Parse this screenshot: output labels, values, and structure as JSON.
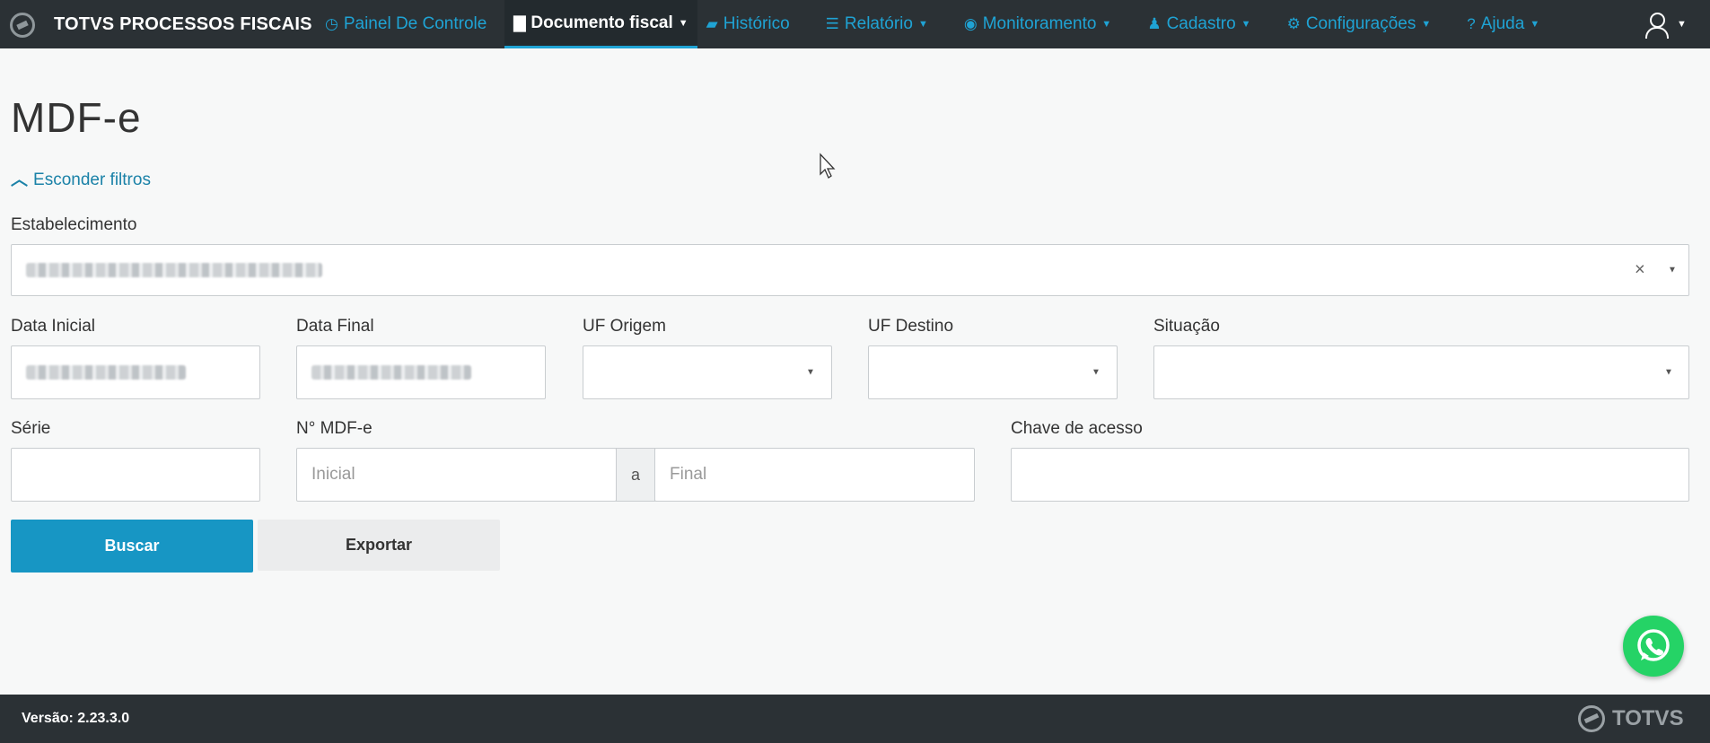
{
  "app": {
    "title": "TOTVS PROCESSOS FISCAIS"
  },
  "nav": {
    "items": [
      {
        "label": "Painel De Controle",
        "icon": "dashboard-icon",
        "has_caret": false,
        "active": false
      },
      {
        "label": "Documento fiscal",
        "icon": "document-icon",
        "has_caret": true,
        "active": true
      },
      {
        "label": "Histórico",
        "icon": "folder-open-icon",
        "has_caret": false,
        "active": false
      },
      {
        "label": "Relatório",
        "icon": "list-icon",
        "has_caret": true,
        "active": false
      },
      {
        "label": "Monitoramento",
        "icon": "eye-icon",
        "has_caret": true,
        "active": false
      },
      {
        "label": "Cadastro",
        "icon": "register-icon",
        "has_caret": true,
        "active": false
      },
      {
        "label": "Configurações",
        "icon": "gear-icon",
        "has_caret": true,
        "active": false
      },
      {
        "label": "Ajuda",
        "icon": "question-icon",
        "has_caret": true,
        "active": false
      }
    ]
  },
  "page": {
    "title": "MDF-e",
    "toggle_filters": "Esconder filtros"
  },
  "filters": {
    "estabelecimento": {
      "label": "Estabelecimento",
      "value_hidden": true
    },
    "data_inicial": {
      "label": "Data Inicial",
      "value_hidden": true
    },
    "data_final": {
      "label": "Data Final",
      "value_hidden": true
    },
    "uf_origem": {
      "label": "UF Origem",
      "value": ""
    },
    "uf_destino": {
      "label": "UF Destino",
      "value": ""
    },
    "situacao": {
      "label": "Situação",
      "value": ""
    },
    "serie": {
      "label": "Série",
      "value": ""
    },
    "numero": {
      "label": "N° MDF-e",
      "from_placeholder": "Inicial",
      "separator": "a",
      "to_placeholder": "Final"
    },
    "chave": {
      "label": "Chave de acesso",
      "value": ""
    }
  },
  "actions": {
    "search_label": "Buscar",
    "export_label": "Exportar"
  },
  "footer": {
    "version": "Versão: 2.23.3.0",
    "logo_text": "TOTVS"
  },
  "colors": {
    "navbar_bg": "#2b3135",
    "accent": "#1fa3d4",
    "primary_button": "#1796c4",
    "whatsapp": "#25d366"
  }
}
